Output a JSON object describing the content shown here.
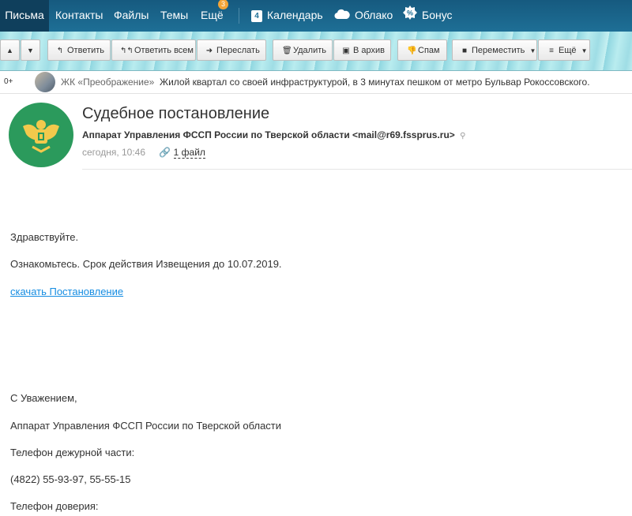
{
  "nav": {
    "items": [
      {
        "label": "Письма",
        "active": true
      },
      {
        "label": "Контакты"
      },
      {
        "label": "Файлы"
      },
      {
        "label": "Темы"
      },
      {
        "label": "Ещё",
        "badge": "3"
      }
    ],
    "apps": [
      {
        "label": "Календарь",
        "icon": "calendar-icon",
        "icon_text": "4"
      },
      {
        "label": "Облако",
        "icon": "cloud-icon"
      },
      {
        "label": "Бонус",
        "icon": "bonus-icon"
      }
    ]
  },
  "toolbar": {
    "reply": "Ответить",
    "reply_all": "Ответить всем",
    "forward": "Переслать",
    "delete": "Удалить",
    "archive": "В архив",
    "spam": "Спам",
    "move": "Переместить",
    "more": "Ещё"
  },
  "ad": {
    "counter": "0+",
    "advertiser": "ЖК «Преображение»",
    "text": "Жилой квартал со своей инфраструктурой, в 3 минутах пешком от метро Бульвар Рокоссовского."
  },
  "letter": {
    "subject": "Судебное постановление",
    "from": "Аппарат Управления ФССП России по Тверской области <mail@r69.fssprus.ru>",
    "date": "сегодня, 10:46",
    "attachments": "1 файл",
    "greeting": "Здравствуйте.",
    "line1": "Ознакомьтесь. Срок действия Извещения до 10.07.2019.",
    "link": "скачать Постановление",
    "regards": "С Уважением,",
    "signature_org": "Аппарат Управления ФССП России по Тверской области",
    "duty_phone_label": "Телефон дежурной части:",
    "duty_phone": "(4822) 55-93-97, 55-55-15",
    "trust_phone_label": "Телефон доверия:"
  },
  "colors": {
    "nav": "#1e6f96",
    "link": "#168de2",
    "logo": "#2b9a5c",
    "badge": "#f3a437"
  }
}
